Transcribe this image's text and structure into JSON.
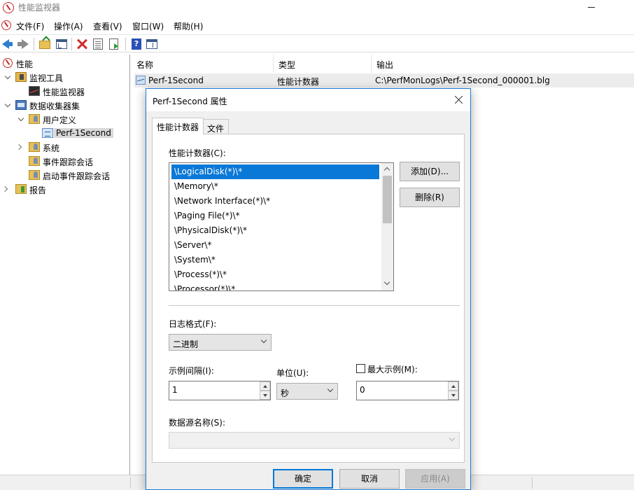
{
  "window": {
    "title": "性能监视器"
  },
  "menu": [
    "文件(F)",
    "操作(A)",
    "查看(V)",
    "窗口(W)",
    "帮助(H)"
  ],
  "toolbar": [
    "back-icon",
    "forward-icon",
    "up-folder-icon",
    "console-tree-icon",
    "delete-icon",
    "properties-icon",
    "export-list-icon",
    "help-icon",
    "show-hide-pane-icon"
  ],
  "tree": {
    "root": "性能",
    "monitoring_tools": "监视工具",
    "performance_monitor": "性能监视器",
    "data_collector_sets": "数据收集器集",
    "user_defined": "用户定义",
    "perf_1second": "Perf-1Second",
    "system": "系统",
    "event_trace_sessions": "事件跟踪会话",
    "startup_event_trace_sessions": "启动事件跟踪会话",
    "reports": "报告"
  },
  "list": {
    "columns": {
      "name": "名称",
      "type": "类型",
      "output": "输出"
    },
    "rows": [
      {
        "name": "Perf-1Second",
        "type": "性能计数器",
        "output": "C:\\PerfMonLogs\\Perf-1Second_000001.blg"
      }
    ]
  },
  "dialog": {
    "title": "Perf-1Second 属性",
    "tabs": [
      "性能计数器",
      "文件"
    ],
    "counters_label": "性能计数器(C):",
    "counters": [
      "\\LogicalDisk(*)\\*",
      "\\Memory\\*",
      "\\Network Interface(*)\\*",
      "\\Paging File(*)\\*",
      "\\PhysicalDisk(*)\\*",
      "\\Server\\*",
      "\\System\\*",
      "\\Process(*)\\*",
      "\\Processor(*)\\*"
    ],
    "add_button": "添加(D)...",
    "remove_button": "删除(R)",
    "log_format_label": "日志格式(F):",
    "log_format_value": "二进制",
    "sample_interval_label": "示例间隔(I):",
    "sample_interval_value": "1",
    "units_label": "单位(U):",
    "units_value": "秒",
    "max_samples_label": "最大示例(M):",
    "max_samples_checked": false,
    "max_samples_value": "0",
    "data_source_label": "数据源名称(S):",
    "data_source_value": "",
    "ok_button": "确定",
    "cancel_button": "取消",
    "apply_button": "应用(A)"
  },
  "colors": {
    "selection": "#0a78d7",
    "dialog_border": "#1f7ad6"
  }
}
